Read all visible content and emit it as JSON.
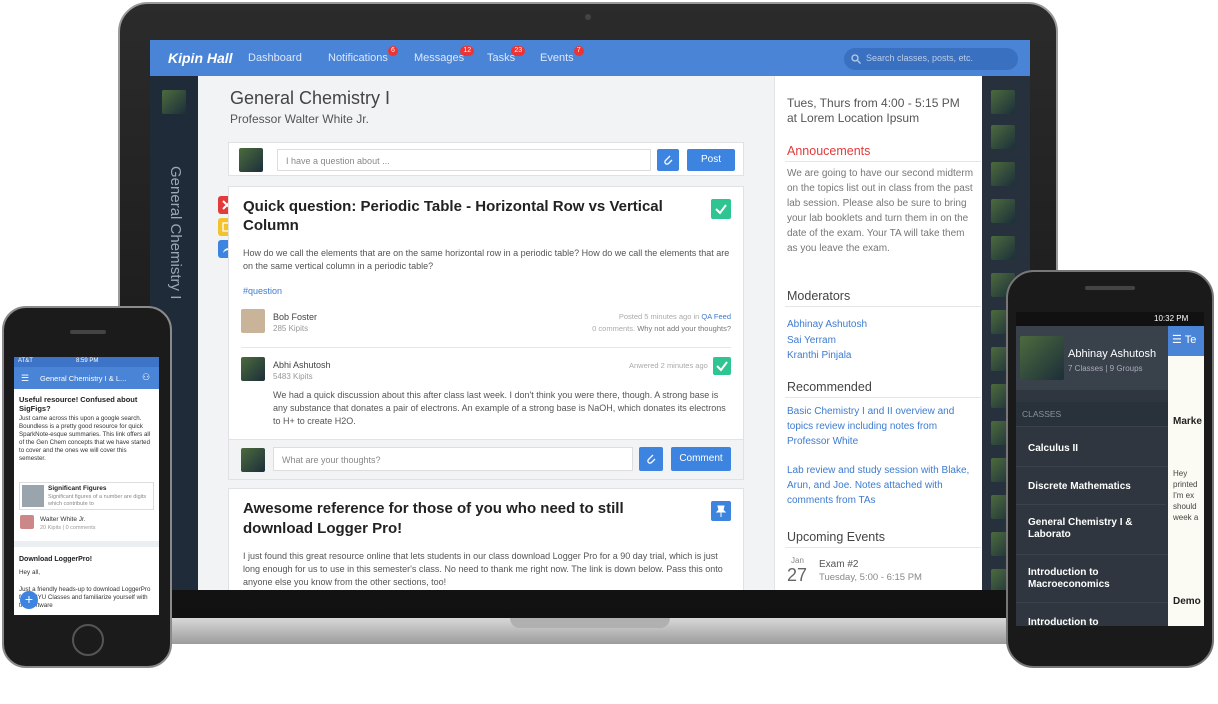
{
  "brand": "Kipin Hall",
  "nav": {
    "items": [
      {
        "label": "Dashboard",
        "badge": ""
      },
      {
        "label": "Notifications",
        "badge": "6"
      },
      {
        "label": "Messages",
        "badge": "12"
      },
      {
        "label": "Tasks",
        "badge": "23"
      },
      {
        "label": "Events",
        "badge": "7"
      }
    ],
    "search_placeholder": "Search classes, posts, etc."
  },
  "class": {
    "title": "General Chemistry I",
    "professor": "Professor Walter White Jr.",
    "vertical_title": "General Chemistry I"
  },
  "composer": {
    "placeholder": "I have a question about ...",
    "post_label": "Post"
  },
  "post1": {
    "title": "Quick question: Periodic Table - Horizontal Row vs Vertical Column",
    "body": "How do we call the elements that are on the same horizontal row in a periodic table? How do we call the elements that are on the same vertical column in a periodic table?",
    "tag": "#question",
    "author": "Bob Foster",
    "kipits": "285 Kipits",
    "meta": "Posted 5 minutes ago in",
    "feed": "QA Feed",
    "comments": "0 comments.",
    "prompt": "Why not add your thoughts?",
    "answer": {
      "author": "Abhi Ashutosh",
      "kipits": "5483 Kipits",
      "meta": "Anwered 2 minutes ago",
      "body": "We had a quick discussion about this after class last week. I don't think you were there, though. A strong base is any substance that donates a pair of electrons. An example of a strong base is NaOH, which donates its electrons to H+ to create H2O."
    },
    "comment_placeholder": "What are your thoughts?",
    "comment_label": "Comment"
  },
  "post2": {
    "title": "Awesome reference for those of you who need to still download Logger Pro!",
    "body": "I just found this great resource online that lets students in our class download Logger Pro for a 90 day trial, which is just long enough for us to use in this semester's class. No need to thank me right now. The link is down below. Pass this onto anyone else you know from the other sections, too!"
  },
  "sidebar": {
    "schedule": "Tues, Thurs from 4:00 - 5:15 PM at Lorem Location Ipsum",
    "announcements_title": "Annoucements",
    "announcements": "We are going to have our second midterm on the topics list out in class from the past lab session. Please also be sure to bring your lab booklets and turn them in on the date of the exam. Your TA will take them as you leave the exam.",
    "moderators_title": "Moderators",
    "moderators": [
      "Abhinay Ashutosh",
      "Sai Yerram",
      "Kranthi Pinjala"
    ],
    "recommended_title": "Recommended",
    "recommended": [
      "Basic Chemistry I and II overview and topics review including notes from Professor White",
      "Lab review and study session with Blake, Arun, and Joe. Notes attached with comments from TAs"
    ],
    "events_title": "Upcoming Events",
    "event": {
      "month": "Jan",
      "day": "27",
      "name": "Exam #2",
      "time": "Tuesday, 5:00 - 6:15 PM"
    }
  },
  "iphone": {
    "carrier": "AT&T",
    "clock": "8:59 PM",
    "header": "General Chemistry I & L...",
    "post_title": "Useful resource! Confused about SigFigs?",
    "post_body": "Just came across this upon a google search. Boundless is a pretty good resource for quick SparkNote-esque summaries. This link offers all of the Gen Chem concepts that we have started to cover and the ones we will cover this semester.",
    "link_title": "Significant Figures",
    "link_desc": "Significant figures of a number are digits which contribute to",
    "author": "Walter White Jr.",
    "author_meta": "20 Kipits | 0 comments",
    "post2_title": "Download LoggerPro!",
    "post2_greet": "Hey all,",
    "post2_body": "Just a friendly heads-up to download LoggerPro from NYU Classes and familiarize yourself with the software"
  },
  "android": {
    "clock": "10:32 PM",
    "user": "Abhinay Ashutosh",
    "user_meta": "7 Classes | 9 Groups",
    "section": "CLASSES",
    "classes": [
      "Calculus II",
      "Discrete Mathematics",
      "General Chemistry I & Laborato",
      "Introduction to Macroeconomics",
      "Introduction to Macroeconomics"
    ],
    "peek_title": "Te",
    "peek_heading": "Marke",
    "peek_text": "Hey printed I'm ex should week a",
    "peek_heading2": "Demo"
  },
  "colors": {
    "accent": "#4a84d6",
    "danger": "#e33b3b",
    "success": "#2fc590",
    "warning": "#f4c22b"
  }
}
